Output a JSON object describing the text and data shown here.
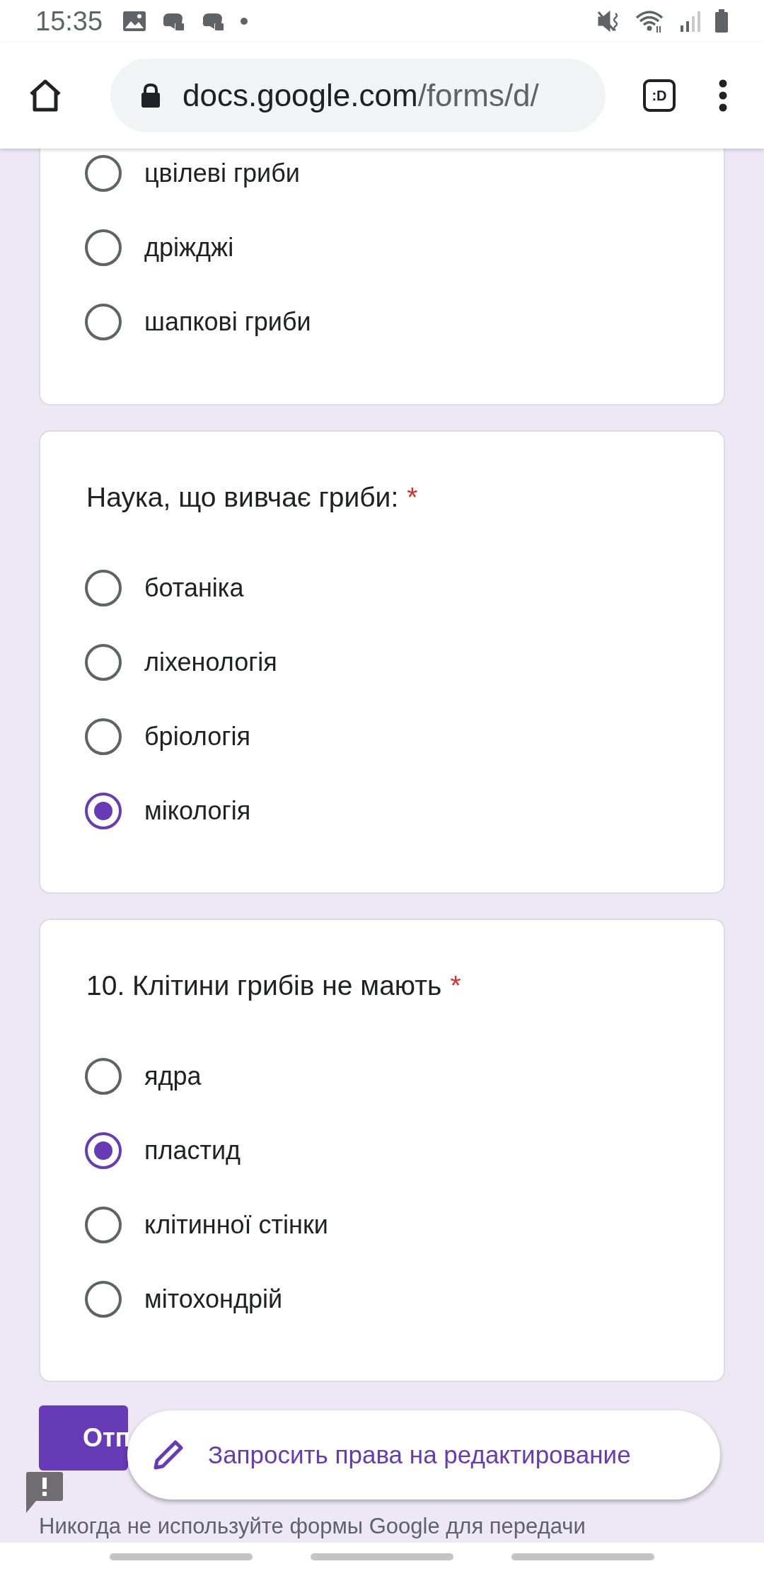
{
  "status_bar": {
    "time": "15:35"
  },
  "browser": {
    "url_host": "docs.google.com",
    "url_path": "/forms/d/",
    "tab_label": ":D"
  },
  "questions": [
    {
      "options": [
        {
          "label": "цвілеві гриби",
          "selected": false
        },
        {
          "label": "дріжджі",
          "selected": false
        },
        {
          "label": "шапкові гриби",
          "selected": false
        }
      ]
    },
    {
      "title": "Наука, що вивчає гриби:",
      "required": true,
      "options": [
        {
          "label": "ботаніка",
          "selected": false
        },
        {
          "label": "ліхенологія",
          "selected": false
        },
        {
          "label": "бріологія",
          "selected": false
        },
        {
          "label": "мікологія",
          "selected": true
        }
      ]
    },
    {
      "title": "10. Клітини грибів не мають",
      "required": true,
      "options": [
        {
          "label": "ядра",
          "selected": false
        },
        {
          "label": "пластид",
          "selected": true
        },
        {
          "label": "клітинної стінки",
          "selected": false
        },
        {
          "label": "мітохондрій",
          "selected": false
        }
      ]
    }
  ],
  "required_mark": "*",
  "submit_button": "Отп",
  "edit_request_button": "Запросить права на редактирование",
  "footer_text": "Никогда не используйте формы Google для передачи"
}
